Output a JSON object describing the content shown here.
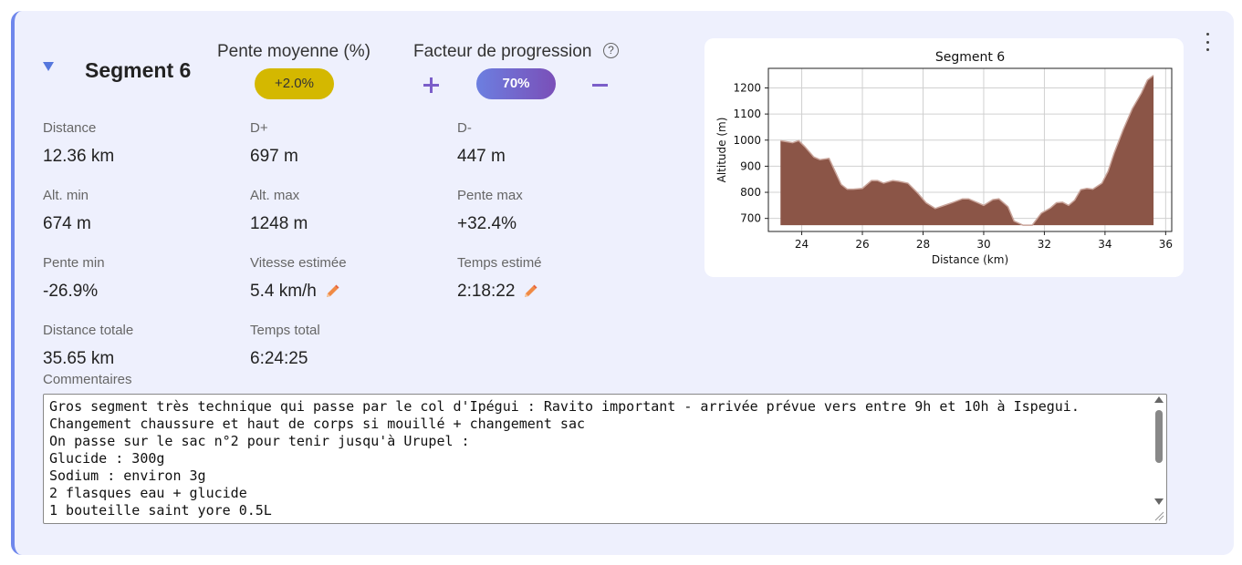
{
  "segment": {
    "title": "Segment 6"
  },
  "slope_group": {
    "label": "Pente moyenne (%)",
    "value": "+2.0%",
    "color": "#d4b800"
  },
  "progression_group": {
    "label": "Facteur de progression",
    "help_symbol": "?",
    "value": "70%",
    "plus_label": "+",
    "minus_label": "−",
    "accent_color": "#7b5ec9"
  },
  "stats": [
    {
      "label": "Distance",
      "value": "12.36 km"
    },
    {
      "label": "D+",
      "value": "697 m"
    },
    {
      "label": "D-",
      "value": "447 m"
    },
    {
      "label": "Alt. min",
      "value": "674 m"
    },
    {
      "label": "Alt. max",
      "value": "1248 m"
    },
    {
      "label": "Pente max",
      "value": "+32.4%"
    },
    {
      "label": "Pente min",
      "value": "-26.9%"
    },
    {
      "label": "Vitesse estimée",
      "value": "5.4 km/h",
      "editable": true
    },
    {
      "label": "Temps estimé",
      "value": "2:18:22",
      "editable": true
    },
    {
      "label": "Distance totale",
      "value": "35.65 km"
    },
    {
      "label": "Temps total",
      "value": "6:24:25"
    }
  ],
  "comments": {
    "label": "Commentaires",
    "text": "Gros segment très technique qui passe par le col d'Ipégui : Ravito important - arrivée prévue vers entre 9h et 10h à Ispegui.\nChangement chaussure et haut de corps si mouillé + changement sac\nOn passe sur le sac n°2 pour tenir jusqu'à Urupel :\nGlucide : 300g\nSodium : environ 3g\n2 flasques eau + glucide\n1 bouteille saint yore 0.5L"
  },
  "chart_data": {
    "type": "area",
    "title": "Segment 6",
    "xlabel": "Distance (km)",
    "ylabel": "Altitude (m)",
    "xlim": [
      22.9,
      36.2
    ],
    "ylim": [
      650,
      1275
    ],
    "xticks": [
      24,
      26,
      28,
      30,
      32,
      34,
      36
    ],
    "yticks": [
      700,
      800,
      900,
      1000,
      1100,
      1200
    ],
    "grid": true,
    "fill_color": "#8b5547",
    "line_color": "#c9a49a",
    "baseline": 674,
    "x": [
      23.3,
      23.7,
      23.9,
      24.1,
      24.4,
      24.6,
      24.9,
      25.1,
      25.3,
      25.5,
      25.7,
      26.0,
      26.3,
      26.5,
      26.7,
      27.0,
      27.2,
      27.5,
      27.8,
      28.1,
      28.4,
      28.7,
      29.0,
      29.3,
      29.5,
      29.8,
      30.0,
      30.3,
      30.5,
      30.8,
      31.0,
      31.3,
      31.6,
      31.9,
      32.2,
      32.4,
      32.6,
      32.8,
      33.0,
      33.2,
      33.4,
      33.6,
      33.9,
      34.1,
      34.3,
      34.6,
      34.9,
      35.2,
      35.4,
      35.6
    ],
    "y": [
      998,
      990,
      998,
      975,
      935,
      925,
      930,
      880,
      830,
      812,
      812,
      815,
      845,
      845,
      835,
      845,
      842,
      835,
      800,
      760,
      738,
      750,
      762,
      775,
      775,
      760,
      750,
      772,
      775,
      745,
      690,
      674,
      674,
      720,
      740,
      760,
      762,
      750,
      770,
      810,
      815,
      812,
      835,
      880,
      950,
      1040,
      1120,
      1180,
      1230,
      1248
    ]
  }
}
